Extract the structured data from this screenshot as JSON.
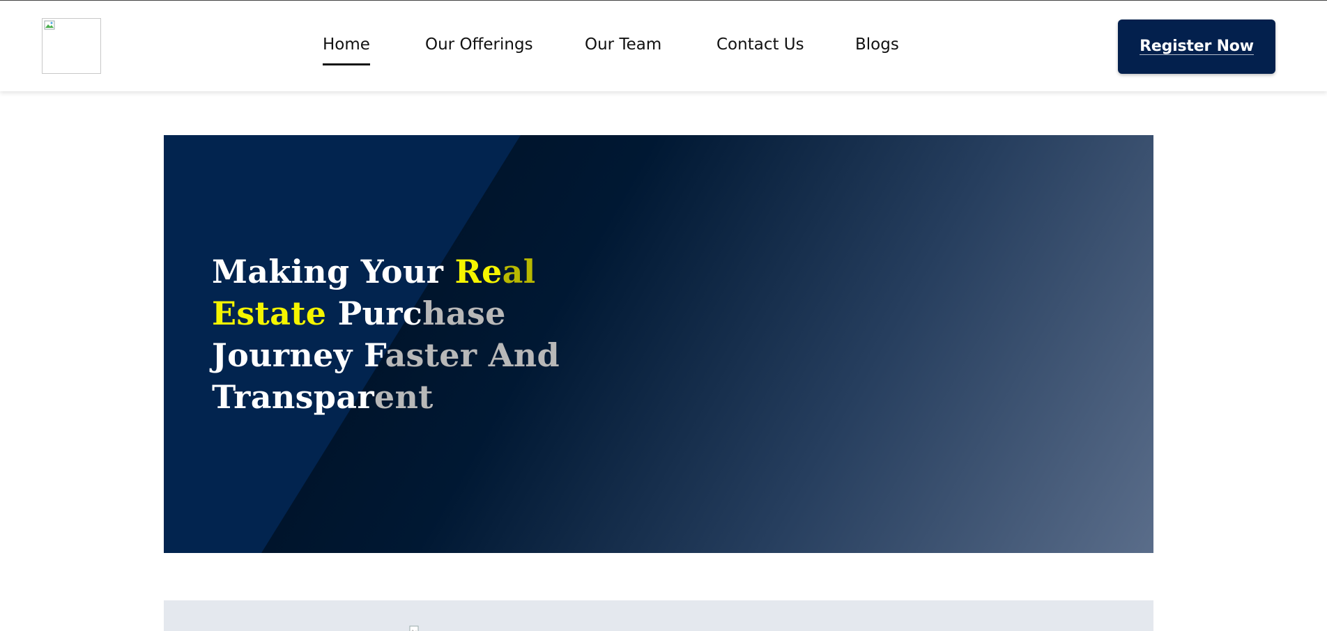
{
  "header": {
    "logo_icon": "broken-image-icon",
    "nav": [
      {
        "label": "Home",
        "active": true
      },
      {
        "label": "Our Offerings",
        "active": false
      },
      {
        "label": "Our Team",
        "active": false
      },
      {
        "label": "Contact Us",
        "active": false
      },
      {
        "label": "Blogs",
        "active": false
      }
    ],
    "register_label": "Register Now"
  },
  "hero": {
    "title": {
      "part1": "Making Your ",
      "part2": "Re",
      "part3": "al",
      "part4": "Estate",
      "part5": " Purc",
      "part6": "hase",
      "part7": "Journey F",
      "part8": "aster And",
      "part9": "Transpar",
      "part10": "ent"
    }
  },
  "colors": {
    "brand_navy": "#03204d",
    "highlight_yellow": "#f5f500"
  },
  "section2": {
    "icon": "broken-image-icon"
  }
}
